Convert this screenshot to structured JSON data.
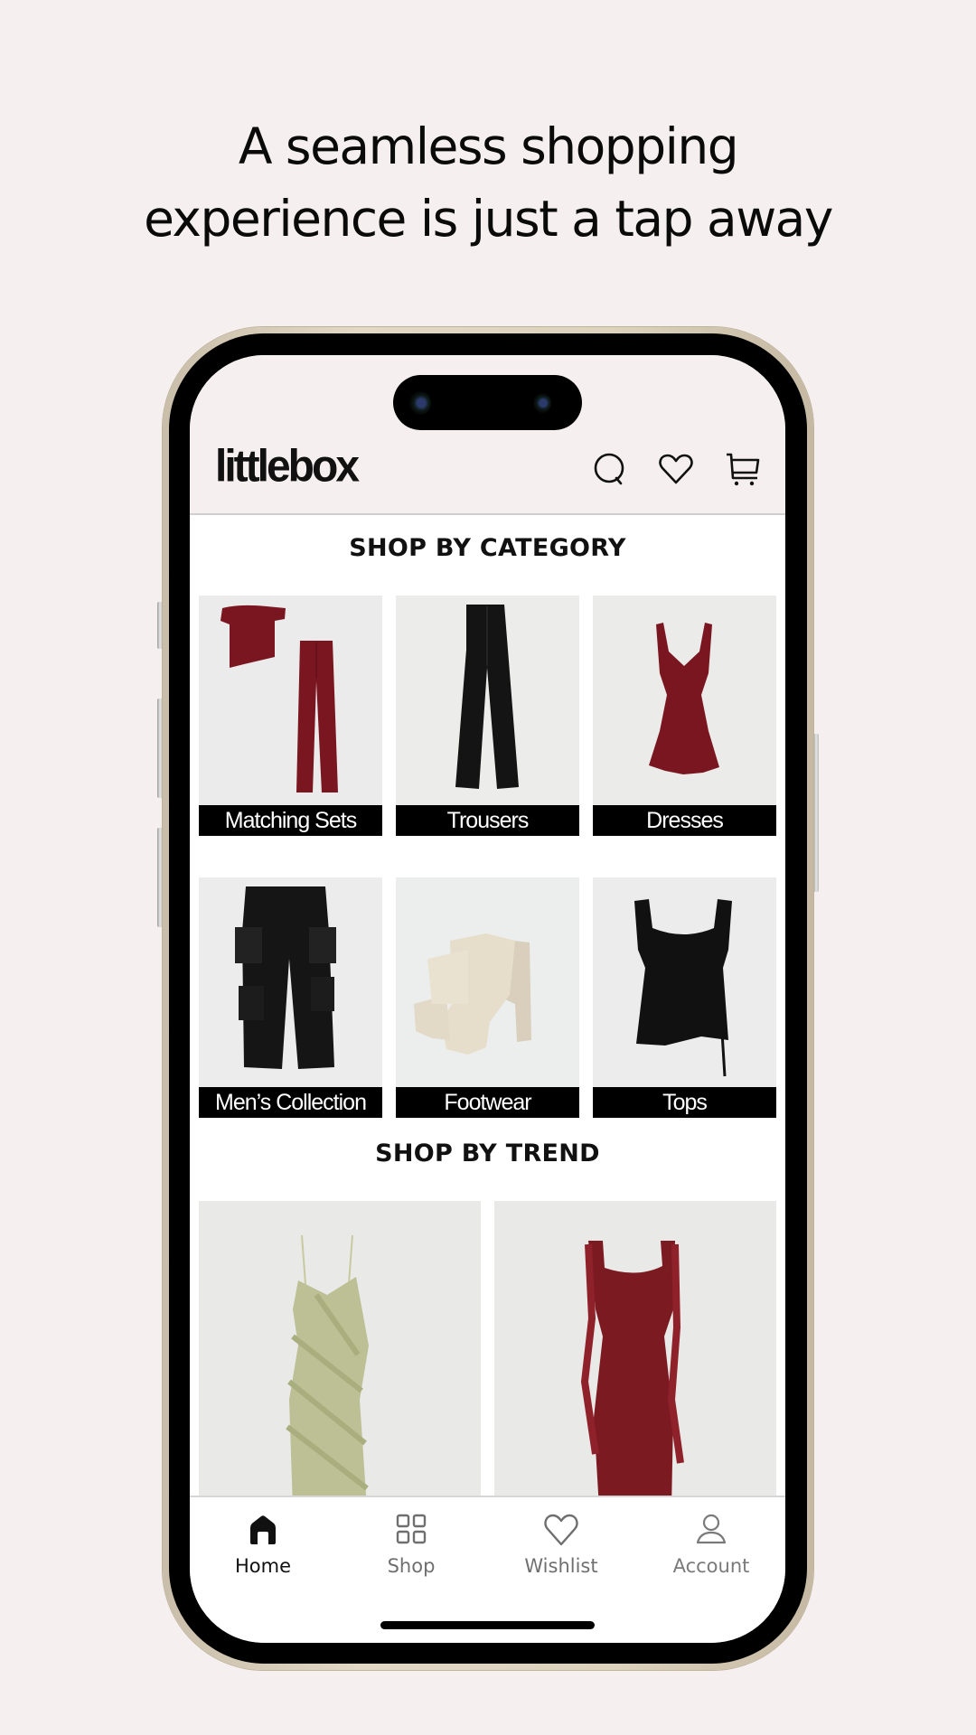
{
  "headline": {
    "line1": "A seamless shopping",
    "line2": "experience is just a tap away"
  },
  "app": {
    "logo": "littlebox",
    "header_icons": [
      "search-icon",
      "heart-icon",
      "cart-icon"
    ]
  },
  "categories": {
    "title": "SHOP BY CATEGORY",
    "items": [
      {
        "label": "Matching Sets",
        "color": "#7a1620"
      },
      {
        "label": "Trousers",
        "color": "#141414"
      },
      {
        "label": "Dresses",
        "color": "#7a1620"
      },
      {
        "label": "Men’s Collection",
        "color": "#141414"
      },
      {
        "label": "Footwear",
        "color": "#e5dccb"
      },
      {
        "label": "Tops",
        "color": "#111111"
      }
    ]
  },
  "trends": {
    "title": "SHOP BY TREND",
    "items": [
      {
        "name": "sage-ruffle-maxi-dress",
        "color": "#b9bd8f"
      },
      {
        "name": "burgundy-ruffle-gown",
        "color": "#7c1a22"
      }
    ]
  },
  "bottom_nav": {
    "items": [
      {
        "label": "Home",
        "icon": "home-icon",
        "active": true
      },
      {
        "label": "Shop",
        "icon": "grid-icon",
        "active": false
      },
      {
        "label": "Wishlist",
        "icon": "heart-icon",
        "active": false
      },
      {
        "label": "Account",
        "icon": "user-icon",
        "active": false
      }
    ]
  },
  "colors": {
    "background": "#f5f0ef",
    "label_bar": "#000000",
    "nav_active": "#111111",
    "nav_inactive": "#6f6f6f"
  }
}
